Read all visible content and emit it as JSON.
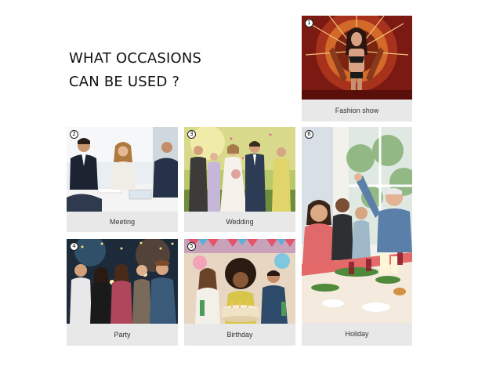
{
  "heading": {
    "line1": "WHAT OCCASIONS",
    "line2": "CAN BE USED ?"
  },
  "cards": [
    {
      "number": "1",
      "label": "Fashion show"
    },
    {
      "number": "2",
      "label": "Meeting"
    },
    {
      "number": "3",
      "label": "Wedding"
    },
    {
      "number": "4",
      "label": "Party"
    },
    {
      "number": "5",
      "label": "Birthday"
    },
    {
      "number": "6",
      "label": "Holiday"
    }
  ]
}
